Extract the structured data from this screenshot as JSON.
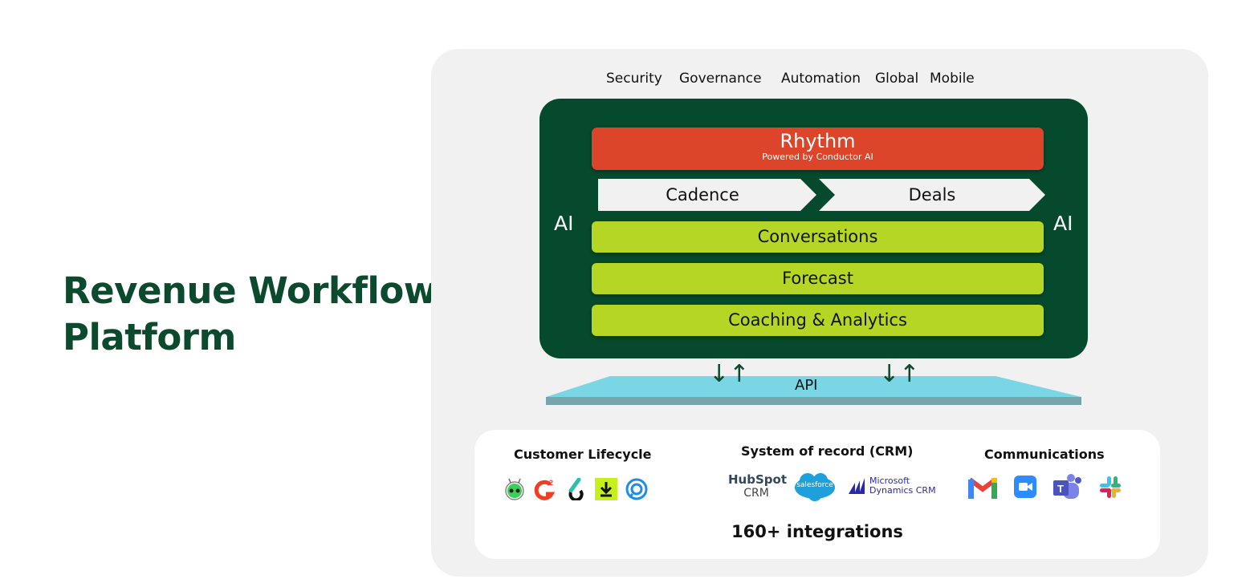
{
  "headline": {
    "line1": "Revenue Workflow",
    "line2": "Platform"
  },
  "pillars": [
    "Security",
    "Governance",
    "Automation",
    "Global",
    "Mobile"
  ],
  "core": {
    "rhythm": {
      "title": "Rhythm",
      "subtitle": "Powered by Conductor AI"
    },
    "chevrons": [
      "Cadence",
      "Deals"
    ],
    "ai_left": "AI",
    "ai_right": "AI",
    "bars": [
      "Conversations",
      "Forecast",
      "Coaching & Analytics"
    ]
  },
  "api": {
    "label": "API",
    "arrow_glyph": "↓↑"
  },
  "integrations": {
    "categories": [
      {
        "title": "Customer Lifecycle",
        "icons": [
          "bot-logo-icon",
          "g2-logo-icon",
          "six-logo-icon",
          "download-logo-icon",
          "circle-logo-icon"
        ]
      },
      {
        "title": "System of record (CRM)",
        "logos": {
          "hubspot": "HubSpot",
          "hubspot_sub": "CRM",
          "salesforce": "salesforce",
          "ms1": "Microsoft",
          "ms2": "Dynamics CRM"
        }
      },
      {
        "title": "Communications",
        "icons": [
          "gmail-icon",
          "zoom-icon",
          "teams-icon",
          "slack-icon"
        ]
      }
    ],
    "count_label": "160+ integrations"
  },
  "colors": {
    "brand_green": "#064a2d",
    "rhythm_red": "#dd452b",
    "lime": "#b5d624",
    "api_blue": "#7ad6e4",
    "panel_gray": "#f1f1f1"
  }
}
